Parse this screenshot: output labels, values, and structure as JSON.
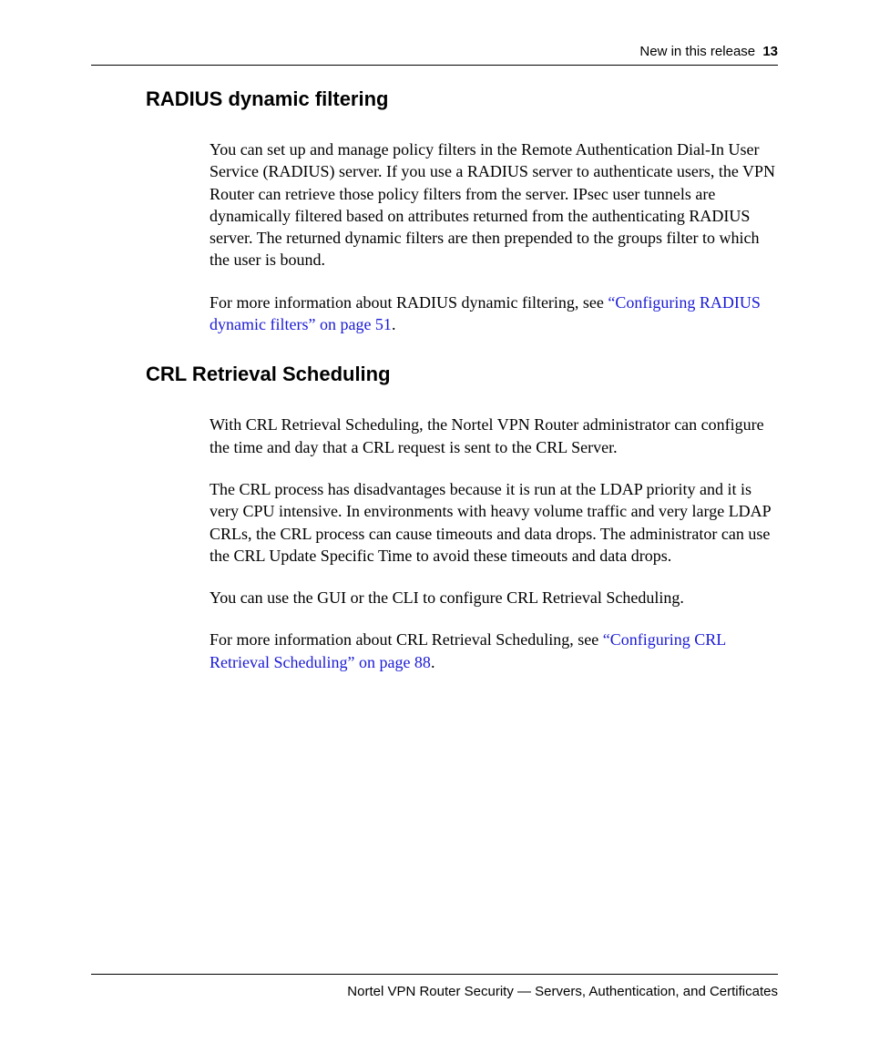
{
  "header": {
    "running_title": "New in this release",
    "page_number": "13"
  },
  "sections": [
    {
      "heading": "RADIUS dynamic filtering",
      "paragraphs": [
        {
          "text": "You can set up and manage policy filters in the Remote Authentication Dial-In User Service (RADIUS) server. If you use a RADIUS server to authenticate users, the VPN Router can retrieve those policy filters from the server. IPsec user tunnels are dynamically filtered based on attributes returned from the authenticating RADIUS server. The returned dynamic filters are then prepended to the groups filter to which the user is bound."
        },
        {
          "text": "For more information about RADIUS dynamic filtering, see ",
          "link": "“Configuring RADIUS dynamic filters” on page 51",
          "after": "."
        }
      ]
    },
    {
      "heading": "CRL Retrieval Scheduling",
      "paragraphs": [
        {
          "text": "With CRL Retrieval Scheduling, the Nortel VPN Router administrator can configure the time and day that a CRL request is sent to the CRL Server."
        },
        {
          "text": "The CRL process has disadvantages because it is run at the LDAP priority and it is very CPU intensive. In environments with heavy volume traffic and very large LDAP CRLs, the CRL process can cause timeouts and data drops. The administrator can use the CRL Update Specific Time to avoid these timeouts and data drops."
        },
        {
          "text": "You can use the GUI or the CLI to configure CRL Retrieval Scheduling."
        },
        {
          "text": "For more information about CRL Retrieval Scheduling, see ",
          "link": "“Configuring CRL Retrieval Scheduling” on page 88",
          "after": "."
        }
      ]
    }
  ],
  "footer": {
    "text": "Nortel VPN Router Security — Servers, Authentication, and Certificates"
  }
}
